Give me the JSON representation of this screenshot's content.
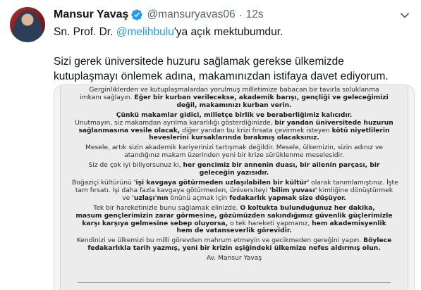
{
  "tweet": {
    "author_name": "Mansur Yavaş",
    "handle": "@mansuryavas06",
    "separator": "·",
    "time": "12s",
    "line1_prefix": "Sn. Prof. Dr. ",
    "mention": "@melihbulu",
    "line1_suffix": "'ya açık mektubumdur.",
    "paragraph2": "Sizi gerek üniversitede huzuru sağlamak gerekse ülkemizde kutuplaşmayı önlemek adına, makamınızdan istifaya davet ediyorum."
  },
  "letter": {
    "lines": [
      [
        {
          "t": "Gerginliklerden ve kutuplaşmalardan yorulmuş milletimize babacan bir tavırla soluklanma"
        }
      ],
      [
        {
          "t": "imkanı sağlayın. "
        },
        {
          "t": "Eğer bir kurban verilecekse, akademik barışı, gençliği ve geleceğimizi",
          "b": true
        }
      ],
      [
        {
          "t": "değil, makamınızı kurban verin.",
          "b": true
        }
      ],
      "sep",
      [
        {
          "t": "Çünkü makamlar gidici, milletçe birlik ve beraberliğimiz kalıcıdır.",
          "b": true
        }
      ],
      [
        {
          "t": "Unutmayın, siz makamdan ayrılma kararlılığı gösterdiğinizde, "
        },
        {
          "t": "bir yandan üniversitede huzurun",
          "b": true
        }
      ],
      [
        {
          "t": "sağlanmasına vesile olacak,",
          "b": true
        },
        {
          "t": " diğer yandan bu krizi fırsata çevirmek isteyen "
        },
        {
          "t": "kötü niyetlilerin",
          "b": true
        }
      ],
      [
        {
          "t": "heveslerini kursaklarında bırakmış olacaksınız.",
          "b": true
        }
      ],
      "sep",
      [
        {
          "t": "Mesele, artık sizin akademik kariyerinizi tartışmak değildir. Mesele, ülkemizin, sizin adınız ve"
        }
      ],
      [
        {
          "t": "atandığınız makam üzerinden yeni bir krize sürüklenme meselesidir."
        }
      ],
      "sep",
      [
        {
          "t": "Siz de çok iyi biliyorsunuz ki, "
        },
        {
          "t": "her gencimiz bir annenin duası, bir ailenin parçası, bir",
          "b": true
        }
      ],
      [
        {
          "t": "geleceğin yazısıdır.",
          "b": true
        }
      ],
      "sep",
      [
        {
          "t": "Boğaziçi kültürünü "
        },
        {
          "t": "'işi kavgaya götürmeden uzlaşılabilen bir kültür'",
          "b": true
        },
        {
          "t": " olarak tanımlamıştınız. İşte"
        }
      ],
      [
        {
          "t": "tam fırsatı. İşi daha fazla kavgaya götürmeden, üniversiteyi "
        },
        {
          "t": "'bilim yuvası'",
          "b": true
        },
        {
          "t": " kimliğine dönüştürmek"
        }
      ],
      [
        {
          "t": "ve "
        },
        {
          "t": "'uzlaşı'nın",
          "b": true
        },
        {
          "t": " önünü açmak için "
        },
        {
          "t": "fedakarlık yapmak size düşüyor.",
          "b": true
        }
      ],
      "sep",
      [
        {
          "t": "Tek bir hareketinizle bunu sağlamak elinizde. "
        },
        {
          "t": "O koltukta bulunduğunuz her dakika,",
          "b": true
        }
      ],
      [
        {
          "t": "masum gençlerimizin zarar görmesine, gözümüzden sakındığımız güvenlik güçlerimizle",
          "b": true
        }
      ],
      [
        {
          "t": "karşı karşıya gelmesine sebep oluyorsa,",
          "b": true
        },
        {
          "t": " o tek hareketi yapmanız, "
        },
        {
          "t": "hem akademisyenlik",
          "b": true
        }
      ],
      [
        {
          "t": "hem de vatanseverlik görevidir.",
          "b": true
        }
      ],
      "sep",
      [
        {
          "t": "Kendinizi ve ülkemizi bu milli görevden mahrum etmeyin ve gecikmeden gereğini yapın. "
        },
        {
          "t": "Böylece",
          "b": true
        }
      ],
      [
        {
          "t": "fedakarlıkla tarih yazmış, yeni bir krizin eşiğindeki ülkemize nefes aldırmış olun.",
          "b": true
        }
      ],
      "sep",
      [
        {
          "t": "Av. Mansur Yavaş"
        }
      ]
    ]
  },
  "icons": {
    "verified": "verified-badge-icon",
    "more": "chevron-down-icon"
  },
  "colors": {
    "accent": "#1d9bf0",
    "text": "#0f1419",
    "muted": "#536471"
  }
}
